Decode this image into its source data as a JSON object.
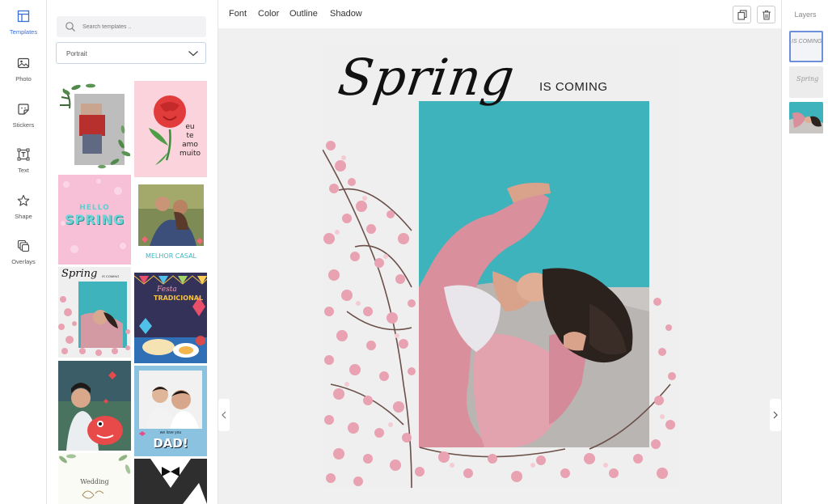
{
  "rail": {
    "items": [
      {
        "label": "Templates",
        "icon": "templates-icon",
        "active": true
      },
      {
        "label": "Photo",
        "icon": "photo-icon"
      },
      {
        "label": "Stickers",
        "icon": "stickers-icon"
      },
      {
        "label": "Text",
        "icon": "text-icon"
      },
      {
        "label": "Shape",
        "icon": "shape-icon"
      },
      {
        "label": "Overlays",
        "icon": "overlays-icon"
      }
    ]
  },
  "panel": {
    "search_placeholder": "Search templates ..",
    "format_value": "Portrait",
    "thumbnails": [
      {
        "kind": "leaves-photo"
      },
      {
        "kind": "eu-te-amo",
        "text": "eu te amo muito"
      },
      {
        "kind": "hello-spring",
        "line1": "HELLO",
        "line2": "SPRING"
      },
      {
        "kind": "melhor-casal",
        "text": "MELHOR CASAL"
      },
      {
        "kind": "spring-mini",
        "script": "Spring",
        "small": "IS COMING"
      },
      {
        "kind": "festa",
        "line1": "Festa",
        "line2": "TRADICIONAL"
      },
      {
        "kind": "monster-selfie"
      },
      {
        "kind": "we-love-dad",
        "small": "we love you",
        "big": "DAD!"
      },
      {
        "kind": "wedding",
        "text": "Wedding"
      },
      {
        "kind": "tuxedo"
      }
    ]
  },
  "toolbar": {
    "font": "Font",
    "color": "Color",
    "outline": "Outline",
    "shadow": "Shadow",
    "duplicate_icon": "copy-icon",
    "delete_icon": "trash-icon"
  },
  "artboard": {
    "script_title": "Spring",
    "subtitle": "IS COMING",
    "colors": {
      "teal": "#3fb3bb",
      "blossom": "#e8a2b1",
      "bg": "#efefef"
    }
  },
  "layers": {
    "title": "Layers",
    "items": [
      {
        "label": "IS COMING",
        "selected": true
      },
      {
        "label": "Spring"
      },
      {
        "label": "photo"
      }
    ]
  }
}
